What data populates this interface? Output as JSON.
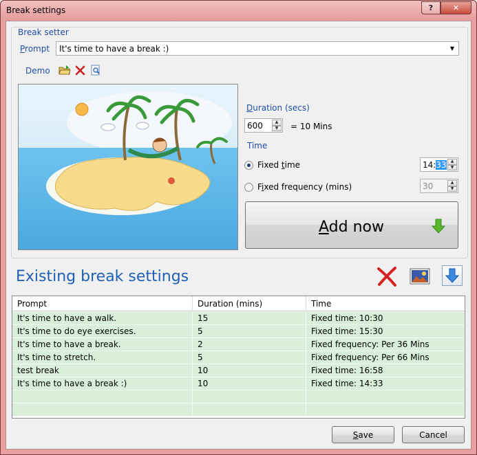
{
  "window": {
    "title": "Break settings",
    "help_glyph": "?",
    "close_glyph": "✕"
  },
  "break_setter": {
    "legend": "Break setter",
    "prompt_label_pre": "",
    "prompt_label_ul": "P",
    "prompt_label_post": "rompt",
    "prompt_value": "It's time to have a break :)",
    "demo_label": "Demo",
    "demo_icons": [
      "open-folder-icon",
      "delete-icon",
      "preview-icon"
    ],
    "duration_label_ul": "D",
    "duration_label_post": "uration (secs)",
    "duration_value": "600",
    "duration_display": "= 10 Mins",
    "time_label": "Time",
    "fixed_time_label_pre": "Fixed ",
    "fixed_time_label_ul": "t",
    "fixed_time_label_post": "ime",
    "fixed_time_hour": "14:",
    "fixed_time_minute": "33",
    "fixed_frequency_label_pre": "F",
    "fixed_frequency_label_ul": "i",
    "fixed_frequency_label_post": "xed frequency (mins)",
    "fixed_frequency_value": "30",
    "selected_mode": "fixed_time",
    "add_now_ul": "A",
    "add_now_post": "dd now"
  },
  "existing": {
    "title": "Existing break settings",
    "columns": [
      "Prompt",
      "Duration (mins)",
      "Time"
    ],
    "rows": [
      [
        "It's time to have a walk.",
        "15",
        "Fixed time: 10:30"
      ],
      [
        "It's time to do eye exercises.",
        "5",
        "Fixed time: 15:30"
      ],
      [
        "It's time to have a break.",
        "2",
        "Fixed frequency: Per 36 Mins"
      ],
      [
        "It's time to stretch.",
        "5",
        "Fixed frequency: Per 66 Mins"
      ],
      [
        "test break",
        "10",
        "Fixed time: 16:58"
      ],
      [
        "It's time to have a break :)",
        "10",
        "Fixed time: 14:33"
      ],
      [
        "",
        "",
        ""
      ],
      [
        "",
        "",
        ""
      ]
    ]
  },
  "buttons": {
    "save_ul": "S",
    "save_post": "ave",
    "cancel": "Cancel"
  },
  "colors": {
    "accent": "#1f5fb8",
    "row_bg": "#d9efd9",
    "titlebar": "#e59c9c"
  }
}
